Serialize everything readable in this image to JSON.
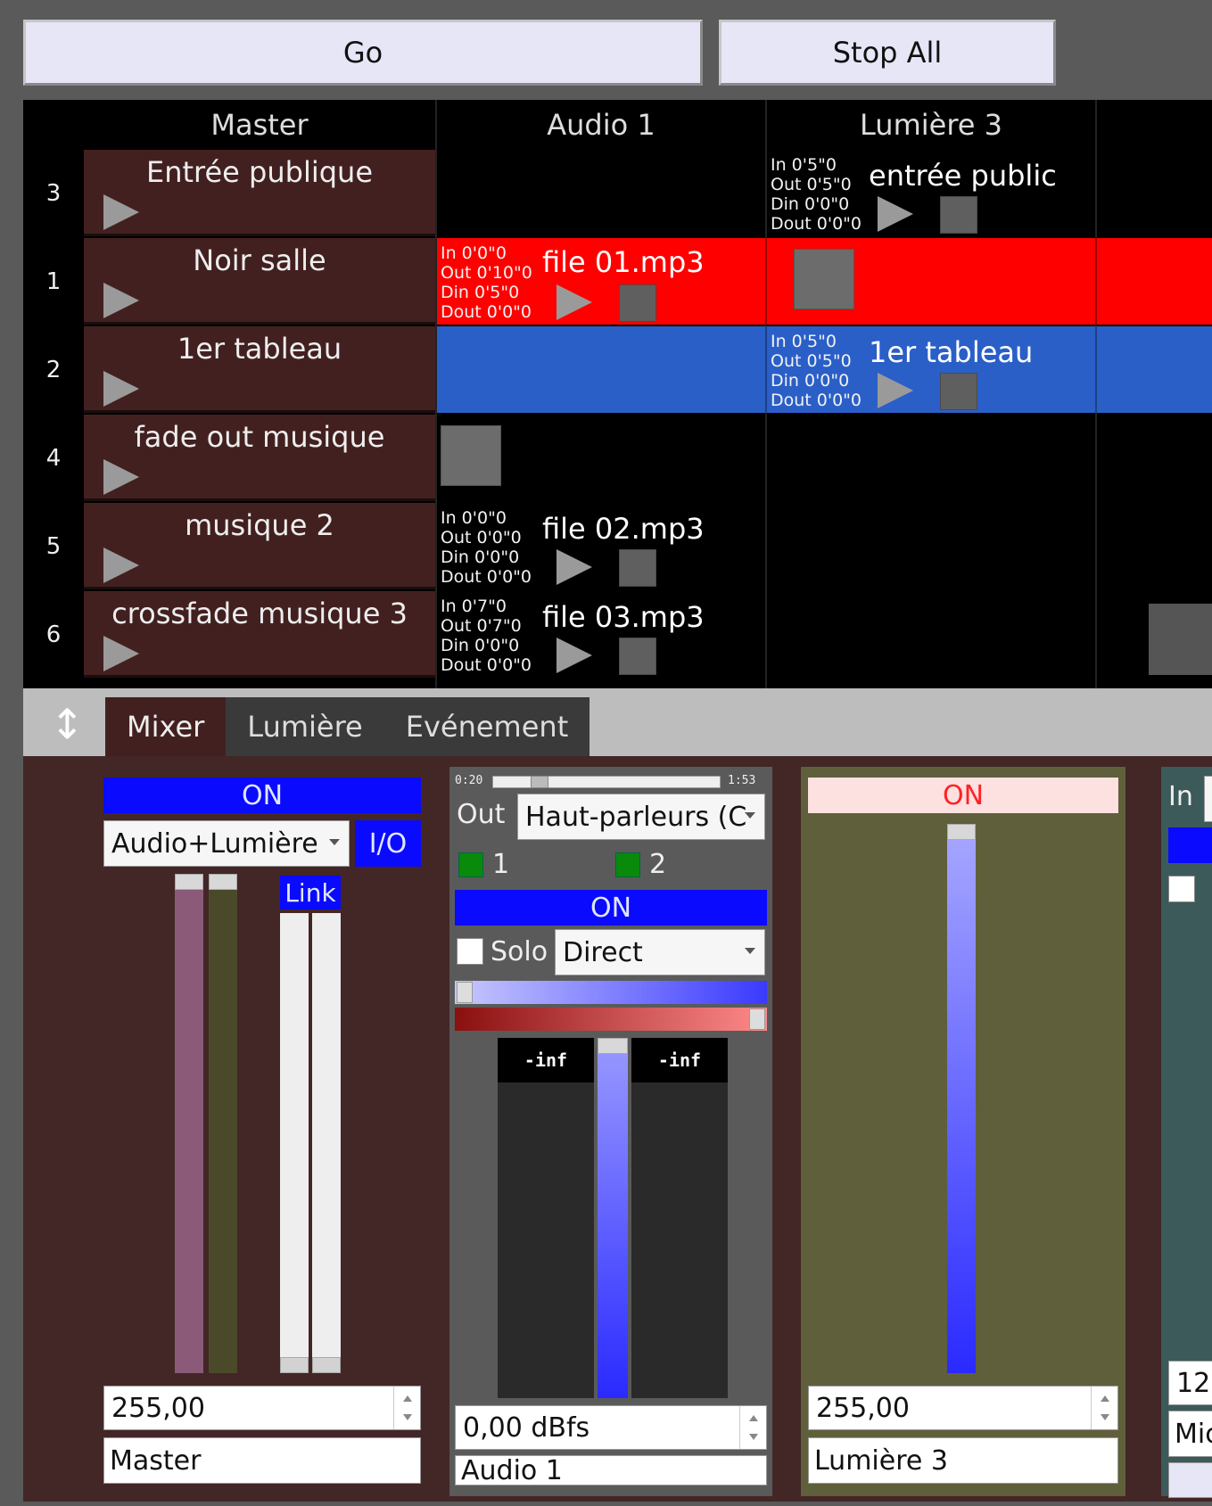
{
  "toolbar": {
    "go_label": "Go",
    "stop_all_label": "Stop All"
  },
  "columns": [
    "Master",
    "Audio 1",
    "Lumière 3"
  ],
  "rows": [
    {
      "num": "3",
      "name": "Entrée publique"
    },
    {
      "num": "1",
      "name": "Noir salle"
    },
    {
      "num": "2",
      "name": "1er tableau"
    },
    {
      "num": "4",
      "name": "fade out musique"
    },
    {
      "num": "5",
      "name": "musique 2"
    },
    {
      "num": "6",
      "name": "crossfade musique 3"
    }
  ],
  "cells": {
    "r0_lum": {
      "times": "In 0'5\"0\nOut 0'5\"0\nDin 0'0\"0\nDout 0'0\"0",
      "file": "entrée public"
    },
    "r1_audio": {
      "times": "In 0'0\"0\nOut 0'10\"0\nDin 0'5\"0\nDout 0'0\"0",
      "file": "file 01.mp3"
    },
    "r2_lum": {
      "times": "In 0'5\"0\nOut 0'5\"0\nDin 0'0\"0\nDout 0'0\"0",
      "file": "1er tableau"
    },
    "r4_audio": {
      "times": "In 0'0\"0\nOut 0'0\"0\nDin 0'0\"0\nDout 0'0\"0",
      "file": "file 02.mp3"
    },
    "r5_audio": {
      "times": "In 0'7\"0\nOut 0'7\"0\nDin 0'0\"0\nDout 0'0\"0",
      "file": "file 03.mp3"
    }
  },
  "row_colors": {
    "red": "#ff0000",
    "blue": "#2a5fc8",
    "master_bg": "#432020"
  },
  "tabs": [
    {
      "label": "Mixer",
      "active": true
    },
    {
      "label": "Lumière",
      "active": false
    },
    {
      "label": "Evénement",
      "active": false
    }
  ],
  "mixer": {
    "master": {
      "on": "ON",
      "mode": "Audio+Lumière",
      "io": "I/O",
      "link": "Link",
      "value": "255,00",
      "name": "Master"
    },
    "audio1": {
      "time_start": "0:20",
      "time_end": "1:53",
      "out_label": "Out",
      "out_device": "Haut-parleurs (C",
      "ch1": "1",
      "ch2": "2",
      "on": "ON",
      "solo": "Solo",
      "routing": "Direct",
      "meter_left": "-inf",
      "meter_right": "-inf",
      "value": "0,00 dBfs",
      "name": "Audio 1"
    },
    "lum3": {
      "on": "ON",
      "value": "255,00",
      "name": "Lumière 3"
    },
    "partial": {
      "in_label": "In",
      "value": "12",
      "name": "Mic"
    }
  }
}
